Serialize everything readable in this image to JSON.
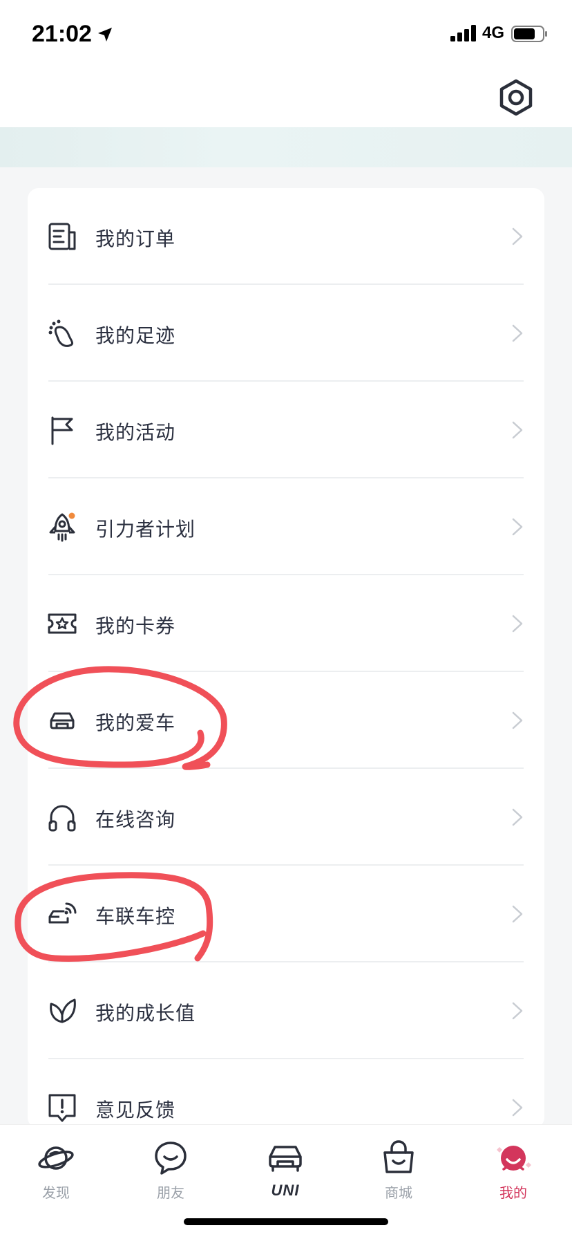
{
  "status_bar": {
    "time": "21:02",
    "network": "4G"
  },
  "menu": {
    "items": [
      {
        "label": "我的订单",
        "icon": "order-list-icon"
      },
      {
        "label": "我的足迹",
        "icon": "footprint-icon"
      },
      {
        "label": "我的活动",
        "icon": "flag-icon"
      },
      {
        "label": "引力者计划",
        "icon": "rocket-icon"
      },
      {
        "label": "我的卡券",
        "icon": "coupon-icon"
      },
      {
        "label": "我的爱车",
        "icon": "car-icon"
      },
      {
        "label": "在线咨询",
        "icon": "headphones-icon"
      },
      {
        "label": "车联车控",
        "icon": "connected-car-icon"
      },
      {
        "label": "我的成长值",
        "icon": "leaf-icon"
      },
      {
        "label": "意见反馈",
        "icon": "feedback-icon"
      }
    ]
  },
  "bottom_nav": {
    "tabs": [
      {
        "label": "发现",
        "icon": "planet-icon"
      },
      {
        "label": "朋友",
        "icon": "chat-bubble-icon"
      },
      {
        "label": "UNI",
        "icon": "car-front-icon"
      },
      {
        "label": "商城",
        "icon": "shopping-bag-icon"
      },
      {
        "label": "我的",
        "icon": "profile-face-icon"
      }
    ],
    "active_tab": "我的"
  },
  "colors": {
    "accent_active": "#d3365c",
    "annotation_red": "#f05058",
    "text_primary": "#2b3040",
    "text_muted": "#9aa0a8"
  }
}
